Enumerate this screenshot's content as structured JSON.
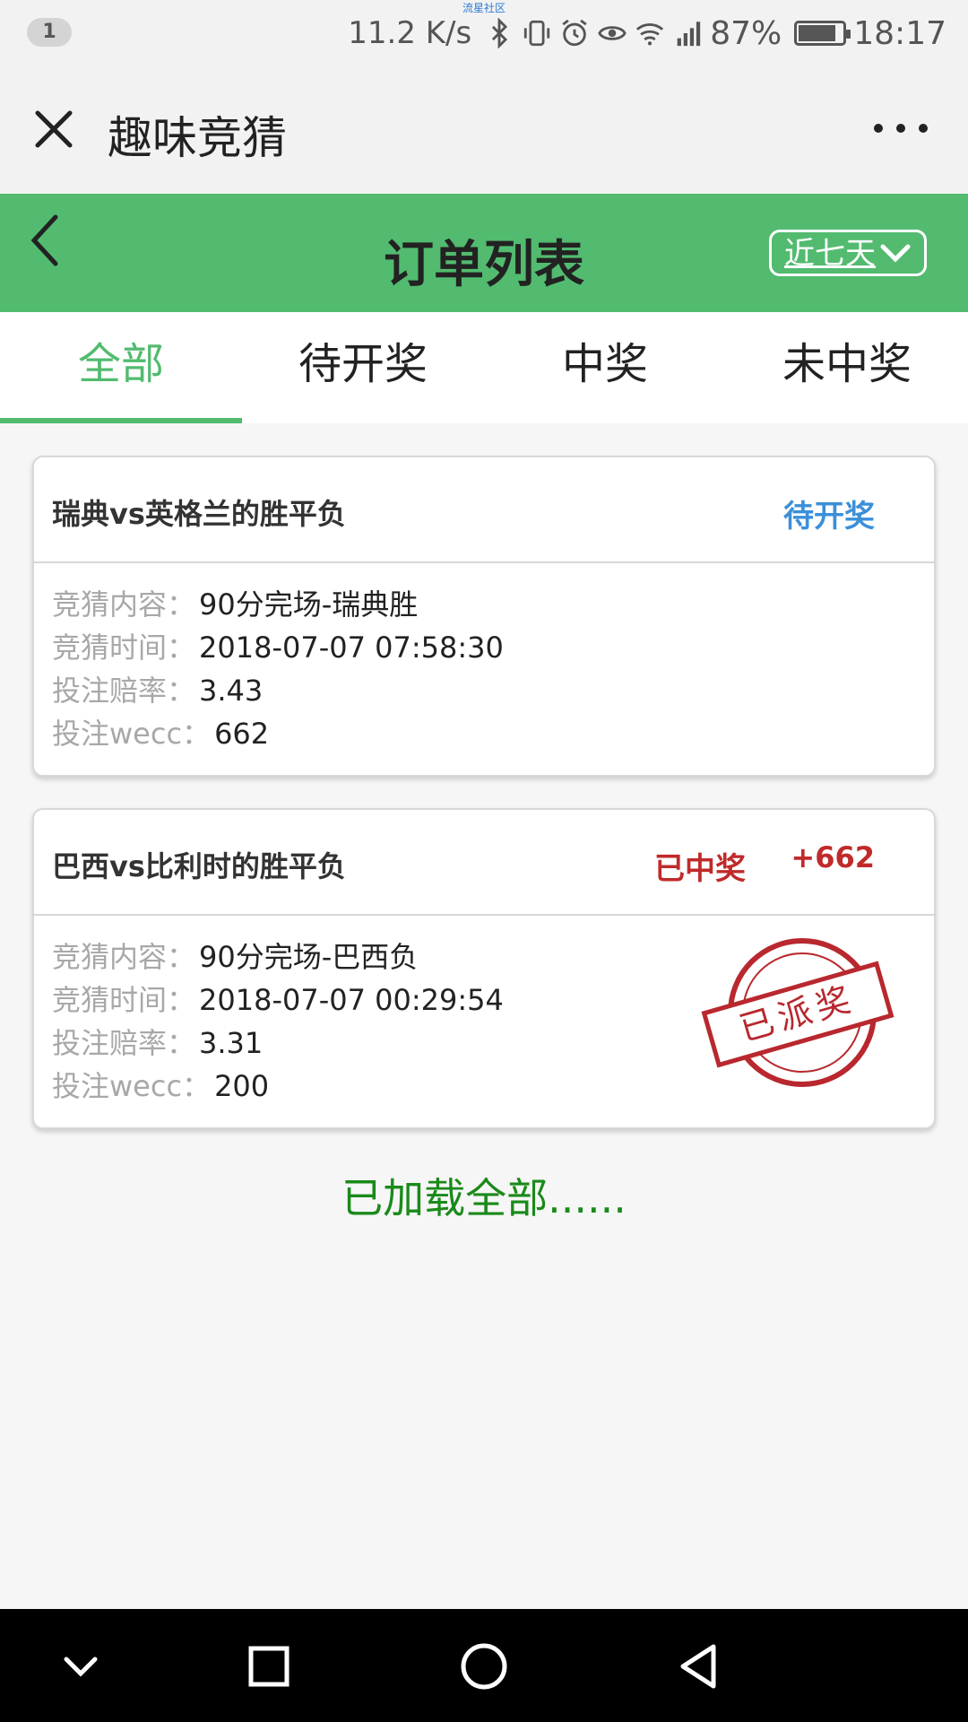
{
  "status_bar": {
    "notification_count": "1",
    "network_speed": "11.2 K/s",
    "battery": "87%",
    "time": "18:17",
    "community_label": "流星社区",
    "icons": [
      "bluetooth-icon",
      "vibrate-icon",
      "alarm-icon",
      "eye-icon",
      "wifi-icon",
      "signal-icon",
      "battery-icon"
    ]
  },
  "app_header": {
    "title": "趣味竞猜",
    "close_icon": "close-icon",
    "more_icon": "more-icon"
  },
  "page_header": {
    "title": "订单列表",
    "back_icon": "back-icon",
    "range_label": "近七天",
    "range_icon": "chevron-down-icon"
  },
  "tabs": [
    {
      "label": "全部",
      "active": true
    },
    {
      "label": "待开奖",
      "active": false
    },
    {
      "label": "中奖",
      "active": false
    },
    {
      "label": "未中奖",
      "active": false
    }
  ],
  "orders": [
    {
      "title": "瑞典vs英格兰的胜平负",
      "status": "待开奖",
      "gain": "",
      "rows": [
        {
          "key": "竞猜内容：",
          "value": "90分完场-瑞典胜"
        },
        {
          "key": "竞猜时间：",
          "value": "2018-07-07 07:58:30"
        },
        {
          "key": "投注赔率：",
          "value": "3.43"
        },
        {
          "key": "投注wecc：",
          "value": "662"
        }
      ]
    },
    {
      "title": "巴西vs比利时的胜平负",
      "status": "已中奖",
      "gain": "+662",
      "stamp": "已派奖",
      "rows": [
        {
          "key": "竞猜内容：",
          "value": "90分完场-巴西负"
        },
        {
          "key": "竞猜时间：",
          "value": "2018-07-07 00:29:54"
        },
        {
          "key": "投注赔率：",
          "value": "3.31"
        },
        {
          "key": "投注wecc：",
          "value": "200"
        }
      ]
    }
  ],
  "footer_text": "已加载全部......",
  "colors": {
    "brand_green": "#52bb6f",
    "pending_blue": "#3b8fd8",
    "won_red": "#c02a2a",
    "loaded_green": "#1a8a1a"
  },
  "nav_bar": {
    "icons": [
      "hide-keyboard-icon",
      "recents-icon",
      "home-icon",
      "back-nav-icon"
    ]
  }
}
